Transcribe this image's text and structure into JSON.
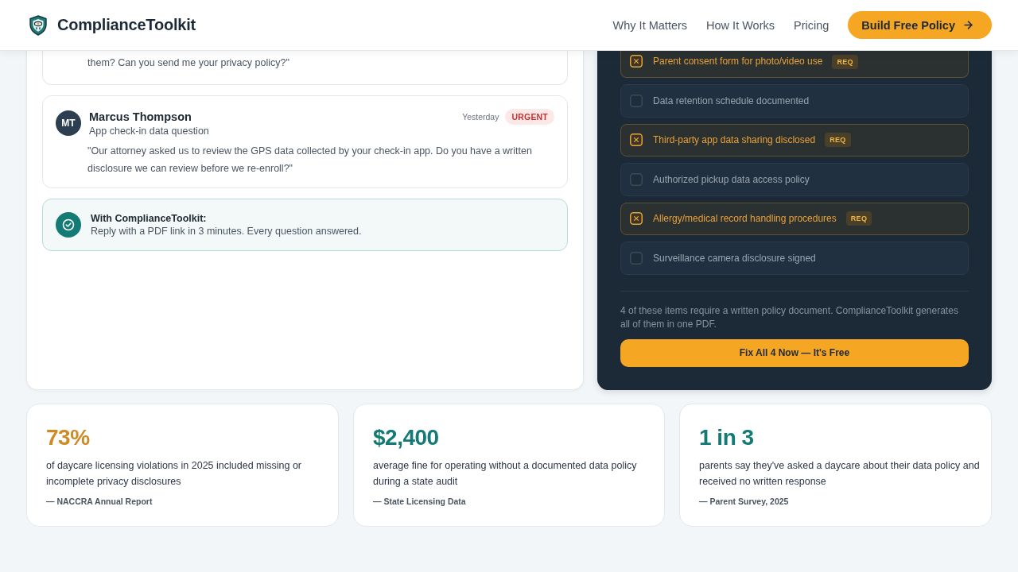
{
  "header": {
    "brand": "ComplianceToolkit",
    "nav": [
      "Why It Matters",
      "How It Works",
      "Pricing"
    ],
    "cta": "Build Free Policy"
  },
  "inbox": {
    "messages": [
      {
        "quote": "them? Can you send me your privacy policy?\""
      },
      {
        "initials": "MT",
        "name": "Marcus Thompson",
        "subject": "App check-in data question",
        "time": "Yesterday",
        "badge": "URGENT",
        "quote": "\"Our attorney asked us to review the GPS data collected by your check-in app. Do you have a written disclosure we can review before we re-enroll?\""
      }
    ],
    "callout": {
      "title": "With ComplianceToolkit:",
      "text": "Reply with a PDF link in 3 minutes. Every question answered."
    }
  },
  "checklist": {
    "items": [
      {
        "label": "Parent consent form for photo/video use",
        "flagged": true,
        "badge": "REQ"
      },
      {
        "label": "Data retention schedule documented",
        "flagged": false
      },
      {
        "label": "Third-party app data sharing disclosed",
        "flagged": true,
        "badge": "REQ"
      },
      {
        "label": "Authorized pickup data access policy",
        "flagged": false
      },
      {
        "label": "Allergy/medical record handling procedures",
        "flagged": true,
        "badge": "REQ"
      },
      {
        "label": "Surveillance camera disclosure signed",
        "flagged": false
      }
    ],
    "note": "4 of these items require a written policy document. ComplianceToolkit generates all of them in one PDF.",
    "button": "Fix All 4 Now — It's Free"
  },
  "stats": [
    {
      "value": "73%",
      "color": "#cf8a25",
      "text": "of daycare licensing violations in 2025 included missing or incomplete privacy disclosures",
      "source": "— NACCRA Annual Report"
    },
    {
      "value": "$2,400",
      "color": "#137a76",
      "text": "average fine for operating without a documented data policy during a state audit",
      "source": "— State Licensing Data"
    },
    {
      "value": "1 in 3",
      "color": "#137a76",
      "text": "parents say they've asked a daycare about their data policy and received no written response",
      "source": "— Parent Survey, 2025"
    }
  ]
}
